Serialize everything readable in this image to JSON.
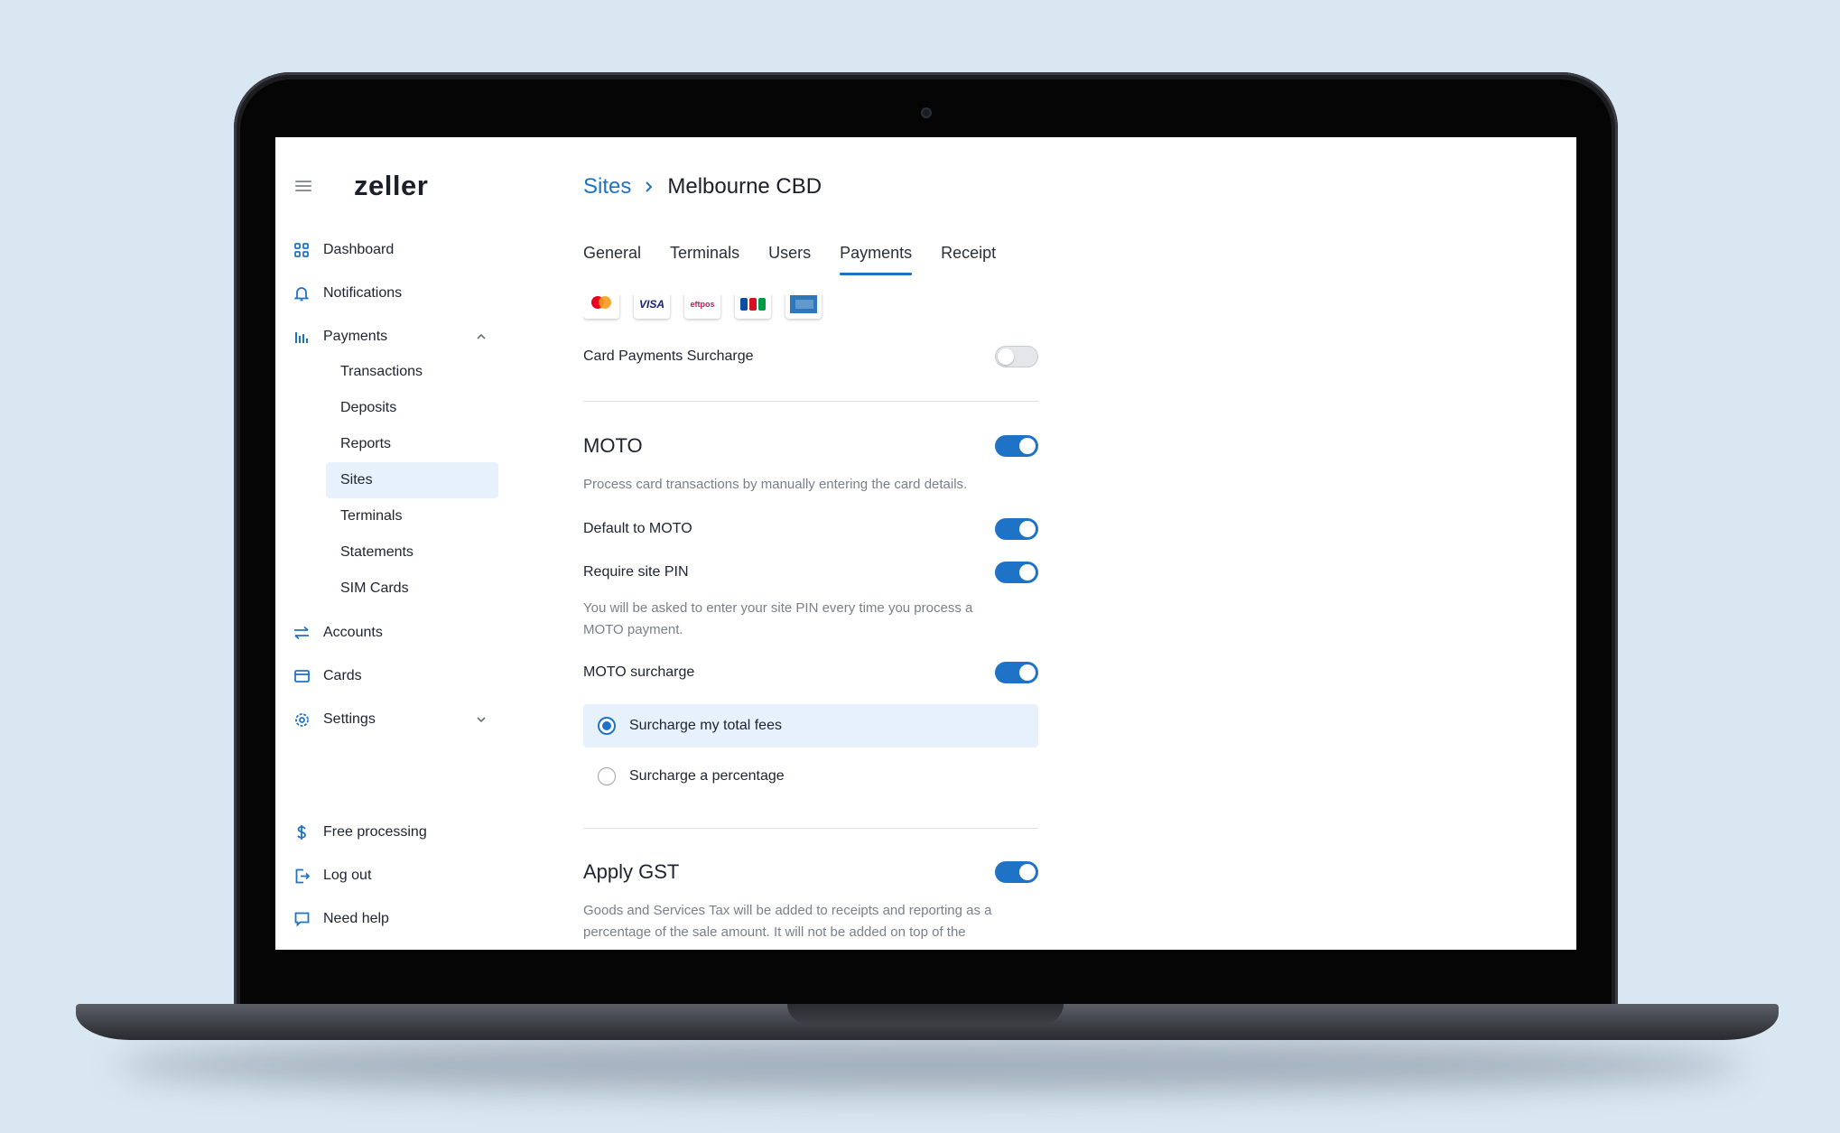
{
  "brand": {
    "logo_text": "zeller"
  },
  "sidebar": {
    "items": [
      {
        "label": "Dashboard",
        "icon": "grid-icon"
      },
      {
        "label": "Notifications",
        "icon": "bell-icon"
      },
      {
        "label": "Payments",
        "icon": "bar-chart-icon",
        "expanded": true
      },
      {
        "label": "Accounts",
        "icon": "transfer-arrows-icon"
      },
      {
        "label": "Cards",
        "icon": "card-icon"
      },
      {
        "label": "Settings",
        "icon": "gear-icon",
        "expanded": false
      }
    ],
    "payments_sub": [
      "Transactions",
      "Deposits",
      "Reports",
      "Sites",
      "Terminals",
      "Statements",
      "SIM Cards"
    ],
    "active_sub": "Sites",
    "footer": [
      {
        "label": "Free processing",
        "icon": "dollar-icon"
      },
      {
        "label": "Log out",
        "icon": "logout-icon"
      },
      {
        "label": "Need help",
        "icon": "chat-icon"
      }
    ]
  },
  "breadcrumb": {
    "parent": "Sites",
    "current": "Melbourne CBD"
  },
  "tabs": [
    {
      "label": "General",
      "active": false
    },
    {
      "label": "Terminals",
      "active": false
    },
    {
      "label": "Users",
      "active": false
    },
    {
      "label": "Payments",
      "active": true
    },
    {
      "label": "Receipt",
      "active": false
    }
  ],
  "payments": {
    "card_logos": [
      "Mastercard",
      "VISA",
      "eftpos",
      "JCB",
      "AMEX"
    ],
    "card_surcharge": {
      "label": "Card Payments Surcharge",
      "on": false
    },
    "moto": {
      "heading": "MOTO",
      "on": true,
      "description": "Process card transactions by manually entering the card details.",
      "default": {
        "label": "Default to MOTO",
        "on": true
      },
      "require_pin": {
        "label": "Require site PIN",
        "on": true
      },
      "pin_description": "You will be asked to enter your site PIN every time you process a MOTO payment.",
      "surcharge": {
        "label": "MOTO surcharge",
        "on": true
      },
      "options": [
        {
          "label": "Surcharge my total fees",
          "selected": true
        },
        {
          "label": "Surcharge a percentage",
          "selected": false
        }
      ]
    },
    "gst": {
      "heading": "Apply GST",
      "on": true,
      "description": "Goods and Services Tax will be added to receipts and reporting as a percentage of the sale amount. It will not be added on top of the"
    }
  },
  "colors": {
    "accent": "#1f73c7",
    "active_bg": "#e6f1fb",
    "text": "#1f2330",
    "muted": "#7a7f8a"
  }
}
